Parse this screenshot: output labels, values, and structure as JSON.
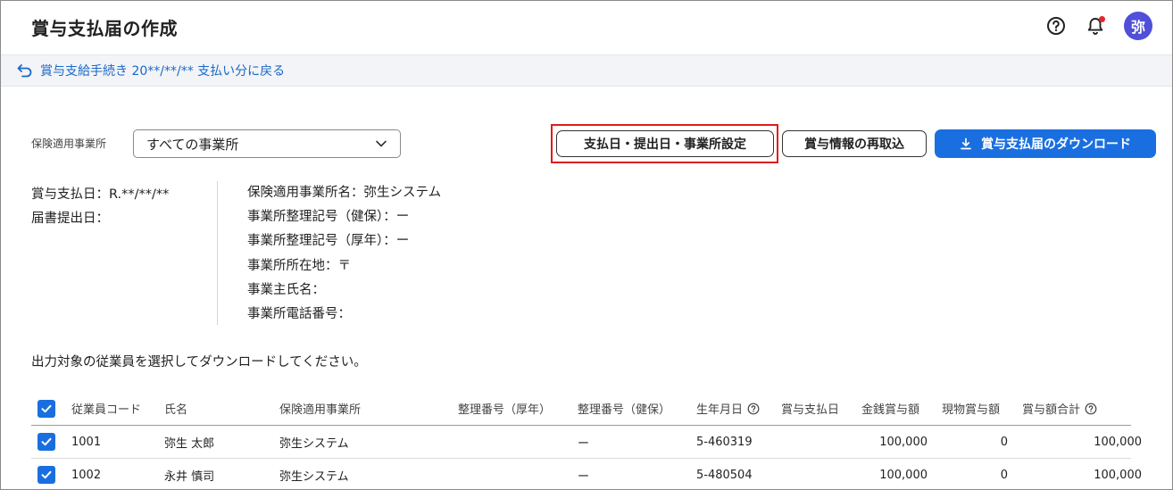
{
  "header": {
    "title": "賞与支払届の作成",
    "avatar_label": "弥"
  },
  "breadcrumb": {
    "back_label": "賞与支給手続き 20**/**/** 支払い分に戻る"
  },
  "filter": {
    "label": "保険適用事業所",
    "selected": "すべての事業所"
  },
  "actions": {
    "settings_label": "支払日・提出日・事業所設定",
    "reimport_label": "賞与情報の再取込",
    "download_label": "賞与支払届のダウンロード"
  },
  "info": {
    "left": [
      "賞与支払日：R.**/**/**",
      "届書提出日："
    ],
    "right": [
      "保険適用事業所名：弥生システム",
      "事業所整理記号（健保）：ー",
      "事業所整理記号（厚年）：ー",
      "事業所所在地：〒",
      "事業主氏名：",
      "事業所電話番号："
    ]
  },
  "instruction": "出力対象の従業員を選択してダウンロードしてください。",
  "table": {
    "headers": {
      "code": "従業員コード",
      "name": "氏名",
      "office": "保険適用事業所",
      "pension_no": "整理番号（厚年）",
      "health_no": "整理番号（健保）",
      "birth": "生年月日",
      "pay_date": "賞与支払日",
      "cash": "金銭賞与額",
      "goods": "現物賞与額",
      "total": "賞与額合計"
    },
    "rows": [
      {
        "code": "1001",
        "name": "弥生 太郎",
        "office": "弥生システム",
        "pension_no": "",
        "health_no": "ー",
        "birth": "5-460319",
        "pay_date": "",
        "cash": "100,000",
        "goods": "0",
        "total": "100,000"
      },
      {
        "code": "1002",
        "name": "永井 慎司",
        "office": "弥生システム",
        "pension_no": "",
        "health_no": "ー",
        "birth": "5-480504",
        "pay_date": "",
        "cash": "100,000",
        "goods": "0",
        "total": "100,000"
      }
    ]
  },
  "colors": {
    "accent": "#1a6fe0",
    "link": "#1a68c8",
    "highlight": "#e01b1b",
    "avatar": "#4f4fd9",
    "notification": "#e5242b"
  }
}
